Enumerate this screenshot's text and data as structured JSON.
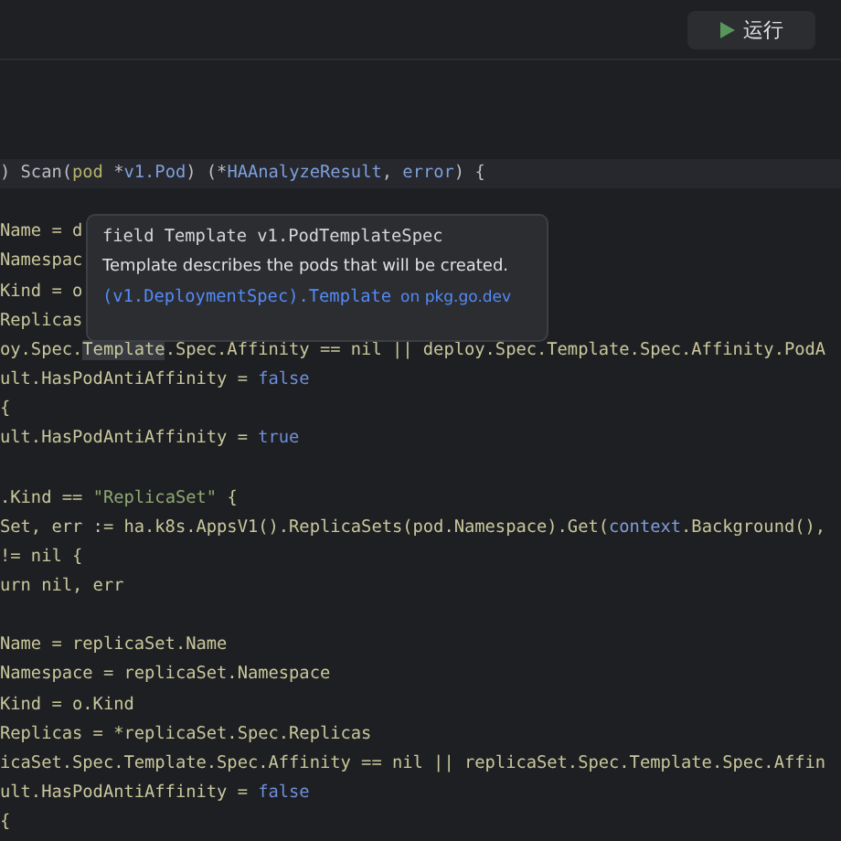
{
  "toolbar": {
    "run_button": {
      "label": "运行"
    }
  },
  "code": {
    "lines": [
      {
        "current": true,
        "segments": [
          {
            "text": ") Scan(",
            "kind": "plain"
          },
          {
            "text": "pod",
            "kind": "param"
          },
          {
            "text": " *",
            "kind": "plain"
          },
          {
            "text": "v1.Pod",
            "kind": "type"
          },
          {
            "text": ") (*",
            "kind": "plain"
          },
          {
            "text": "HAAnalyzeResult",
            "kind": "type"
          },
          {
            "text": ", ",
            "kind": "plain"
          },
          {
            "text": "error",
            "kind": "type"
          },
          {
            "text": ") {",
            "kind": "plain"
          }
        ]
      },
      {
        "gap_before": true,
        "segments": [
          {
            "text": "Name = d",
            "kind": "field"
          }
        ]
      },
      {
        "segments": [
          {
            "text": "Namespac",
            "kind": "field"
          }
        ]
      },
      {
        "segments": [
          {
            "text": "Kind = o",
            "kind": "field"
          }
        ]
      },
      {
        "segments": [
          {
            "text": "Replicas",
            "kind": "field"
          }
        ]
      },
      {
        "segments": [
          {
            "text": "oy.Spec.",
            "kind": "field"
          },
          {
            "text": "Template",
            "kind": "highlight"
          },
          {
            "text": ".Spec.Affinity == nil || deploy.Spec.Template.Spec.Affinity.PodA",
            "kind": "field"
          }
        ]
      },
      {
        "segments": [
          {
            "text": "ult.HasPodAntiAffinity = ",
            "kind": "field"
          },
          {
            "text": "false",
            "kind": "keyword"
          }
        ]
      },
      {
        "segments": [
          {
            "text": "{",
            "kind": "field"
          }
        ]
      },
      {
        "segments": [
          {
            "text": "ult.HasPodAntiAffinity = ",
            "kind": "field"
          },
          {
            "text": "true",
            "kind": "keyword"
          }
        ]
      },
      {
        "gap_before": true,
        "segments": [
          {
            "text": ".Kind == ",
            "kind": "field"
          },
          {
            "text": "\"ReplicaSet\"",
            "kind": "string"
          },
          {
            "text": " {",
            "kind": "field"
          }
        ]
      },
      {
        "segments": [
          {
            "text": "Set, err := ha.k8s.AppsV1().ReplicaSets(pod.Namespace).Get(",
            "kind": "field"
          },
          {
            "text": "context",
            "kind": "type"
          },
          {
            "text": ".Background(),",
            "kind": "field"
          }
        ]
      },
      {
        "segments": [
          {
            "text": "!= nil {",
            "kind": "field"
          }
        ]
      },
      {
        "segments": [
          {
            "text": "urn nil, err",
            "kind": "field"
          }
        ]
      },
      {
        "gap_before": true,
        "segments": [
          {
            "text": "Name = replicaSet.Name",
            "kind": "field"
          }
        ]
      },
      {
        "segments": [
          {
            "text": "Namespace = replicaSet.Namespace",
            "kind": "field"
          }
        ]
      },
      {
        "segments": [
          {
            "text": "Kind = o.Kind",
            "kind": "field"
          }
        ]
      },
      {
        "segments": [
          {
            "text": "Replicas = *replicaSet.Spec.Replicas",
            "kind": "field"
          }
        ]
      },
      {
        "segments": [
          {
            "text": "icaSet.Spec.Template.Spec.Affinity == nil || replicaSet.Spec.Template.Spec.Affin",
            "kind": "field"
          }
        ]
      },
      {
        "segments": [
          {
            "text": "ult.HasPodAntiAffinity = ",
            "kind": "field"
          },
          {
            "text": "false",
            "kind": "keyword"
          }
        ]
      },
      {
        "segments": [
          {
            "text": "{",
            "kind": "field"
          }
        ]
      }
    ]
  },
  "tooltip": {
    "signature": "field Template v1.PodTemplateSpec",
    "description": "Template describes the pods that will be created.",
    "link": "(v1.DeploymentSpec).Template",
    "link_suffix": "on pkg.go.dev"
  }
}
